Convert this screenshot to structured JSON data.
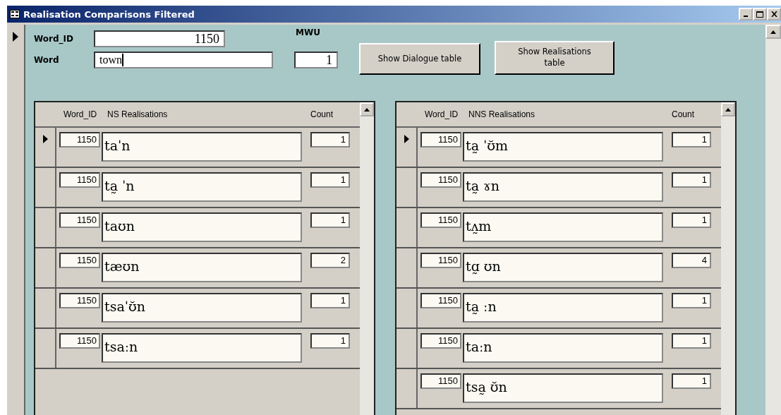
{
  "window": {
    "title": "Realisation Comparisons Filtered"
  },
  "form": {
    "current_record": true,
    "word_id_label": "Word_ID",
    "word_id": "1150",
    "word_label": "Word",
    "word": "town",
    "mwu_label": "MWU",
    "mwu": "1"
  },
  "buttons": [
    "Show Dialogue table",
    "Show Realisations table"
  ],
  "subforms": [
    {
      "columns": [
        "Word_ID",
        "NS Realisations",
        "Count"
      ],
      "rows": [
        {
          "word_id": "1150",
          "realisation": "taˈn",
          "count": "1",
          "selected": true
        },
        {
          "word_id": "1150",
          "realisation": "ta̰ ˈn",
          "count": "1",
          "selected": false
        },
        {
          "word_id": "1150",
          "realisation": "taʊn",
          "count": "1",
          "selected": false
        },
        {
          "word_id": "1150",
          "realisation": "tæʊn",
          "count": "2",
          "selected": false
        },
        {
          "word_id": "1150",
          "realisation": "tsaˈʊ̆n",
          "count": "1",
          "selected": false
        },
        {
          "word_id": "1150",
          "realisation": "tsaːn",
          "count": "1",
          "selected": false
        }
      ]
    },
    {
      "columns": [
        "Word_ID",
        "NNS Realisations",
        "Count"
      ],
      "rows": [
        {
          "word_id": "1150",
          "realisation": "ta̰ ˈʊ̆m",
          "count": "1",
          "selected": true
        },
        {
          "word_id": "1150",
          "realisation": "ta̰ ɤn",
          "count": "1",
          "selected": false
        },
        {
          "word_id": "1150",
          "realisation": "tʌ̰m",
          "count": "1",
          "selected": false
        },
        {
          "word_id": "1150",
          "realisation": "tɑ̰ ʊn",
          "count": "4",
          "selected": false
        },
        {
          "word_id": "1150",
          "realisation": "ta̰ ːn",
          "count": "1",
          "selected": false
        },
        {
          "word_id": "1150",
          "realisation": "taːn",
          "count": "1",
          "selected": false
        },
        {
          "word_id": "1150",
          "realisation": "tsa̰ ʊ̆n",
          "count": "1",
          "selected": false
        }
      ]
    }
  ]
}
